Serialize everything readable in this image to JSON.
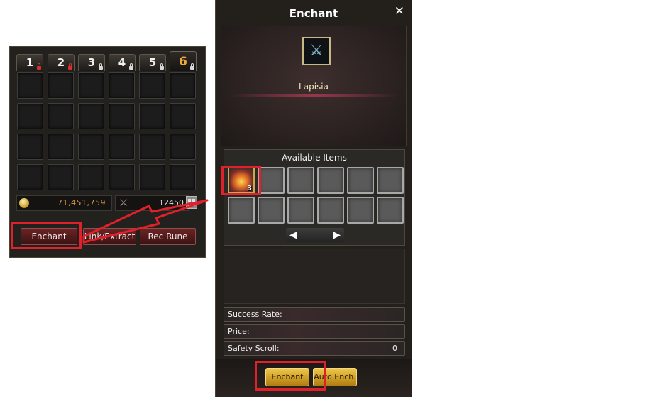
{
  "inventory": {
    "tabs": [
      {
        "label": "1",
        "lock": "red"
      },
      {
        "label": "2",
        "lock": "red"
      },
      {
        "label": "3",
        "lock": "white"
      },
      {
        "label": "4",
        "lock": "white"
      },
      {
        "label": "5",
        "lock": "white"
      },
      {
        "label": "6",
        "lock": "white"
      }
    ],
    "active_tab": "6",
    "gold": "71,451,759",
    "cross_value": "12450",
    "buttons": {
      "enchant": "Enchant",
      "link_extract": "Link/Extract",
      "rec_rune": "Rec Rune"
    }
  },
  "enchant_window": {
    "title": "Enchant",
    "close_icon": "close-icon",
    "weapon_name": "Lapisia",
    "available_title": "Available Items",
    "item_count": "3",
    "pager": {
      "prev": "◀",
      "next": "▶"
    },
    "rows": {
      "success_rate": "Success Rate:",
      "price": "Price:",
      "safety_scroll": "Safety Scroll:",
      "safety_scroll_value": "0"
    },
    "buttons": {
      "enchant": "Enchant",
      "auto_enchant": "Auto Ench."
    }
  },
  "colors": {
    "highlight": "#e0202a",
    "gold_text": "#e19a3c",
    "tab_active": "#f0a838",
    "weapon_name": "#f6e7b8"
  }
}
